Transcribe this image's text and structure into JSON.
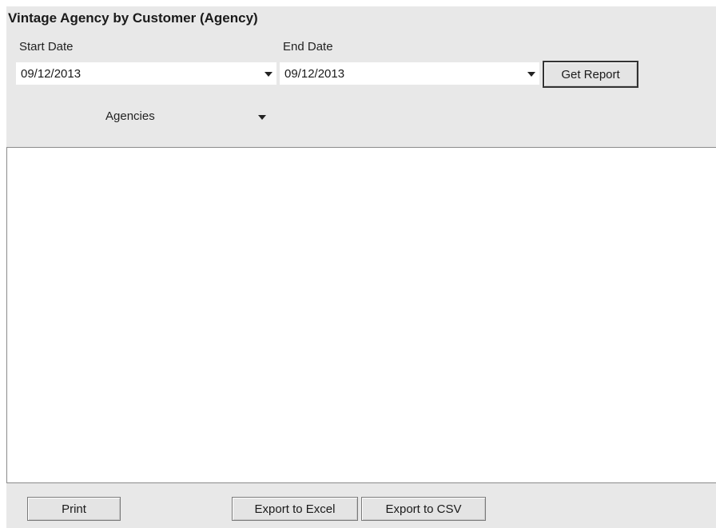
{
  "report": {
    "title": "Vintage Agency by Customer (Agency)"
  },
  "filters": {
    "start_date_label": "Start Date",
    "start_date_value": "09/12/2013",
    "end_date_label": "End Date",
    "end_date_value": "09/12/2013",
    "get_report_label": "Get Report",
    "agencies_label": "Agencies"
  },
  "footer": {
    "print_label": "Print",
    "export_excel_label": "Export to Excel",
    "export_csv_label": "Export to CSV"
  },
  "icons": {
    "dropdown": "chevron-down-icon"
  }
}
